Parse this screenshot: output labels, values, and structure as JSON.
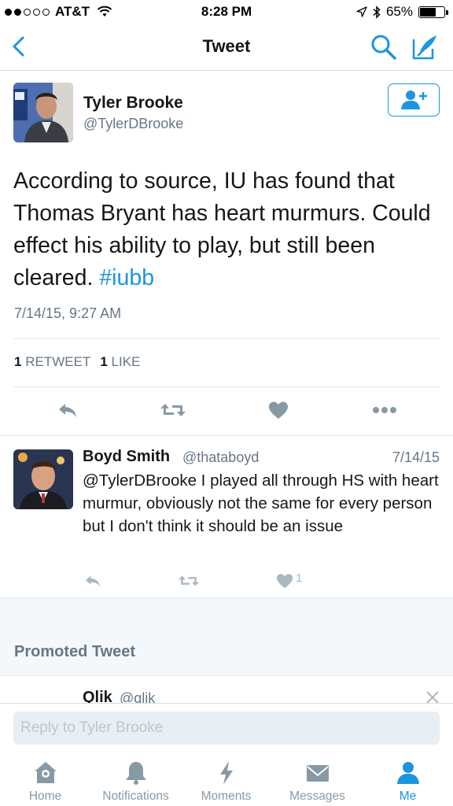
{
  "status_bar": {
    "carrier": "AT&T",
    "time": "8:28 PM",
    "battery": "65%",
    "battery_level": 0.65,
    "signal_bars_filled": 2,
    "signal_bars_total": 5
  },
  "nav": {
    "title": "Tweet",
    "back_icon": "chevron-left-icon",
    "search_icon": "search-icon",
    "compose_icon": "compose-icon",
    "accent_color": "#1b95e0"
  },
  "tweet": {
    "author_name": "Tyler Brooke",
    "author_handle": "@TylerDBrooke",
    "text": "According to source, IU has found that Thomas Bryant has heart murmurs. Could effect his ability to play, but still been cleared.",
    "hashtag": "#iubb",
    "timestamp": "7/14/15, 9:27 AM",
    "retweet_count": "1",
    "retweet_label": "RETWEET",
    "like_count": "1",
    "like_label": "LIKE"
  },
  "reply": {
    "author_name": "Boyd Smith",
    "author_handle": "@thataboyd",
    "date": "7/14/15",
    "text": "@TylerDBrooke I played all through HS with heart murmur, obviously not the same for every person but I don't think it should be an issue",
    "like_count": "1"
  },
  "promoted": {
    "label": "Promoted Tweet",
    "author_name": "Qlik",
    "author_handle": "@qlik"
  },
  "composer": {
    "placeholder": "Reply to Tyler Brooke"
  },
  "tabs": [
    {
      "label": "Home",
      "icon": "home-icon"
    },
    {
      "label": "Notifications",
      "icon": "bell-icon"
    },
    {
      "label": "Moments",
      "icon": "lightning-icon"
    },
    {
      "label": "Messages",
      "icon": "envelope-icon"
    },
    {
      "label": "Me",
      "icon": "person-icon",
      "active": true
    }
  ]
}
